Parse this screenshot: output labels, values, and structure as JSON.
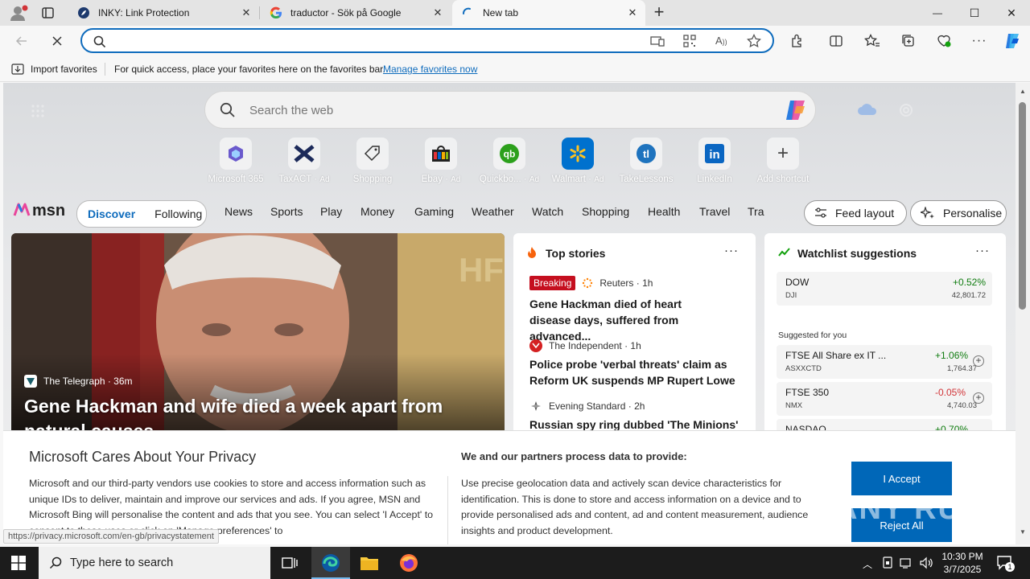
{
  "tabs": [
    {
      "title": "INKY: Link Protection",
      "active": false
    },
    {
      "title": "traductor - Sök på Google",
      "active": false
    },
    {
      "title": "New tab",
      "active": true
    }
  ],
  "window_controls": {
    "minimize": "—",
    "maximize": "☐",
    "close": "✕"
  },
  "address": {
    "value": "",
    "placeholder": ""
  },
  "favorites_bar": {
    "import_label": "Import favorites",
    "hint": "For quick access, place your favorites here on the favorites bar.",
    "manage_link": "Manage favorites now"
  },
  "newtab": {
    "search_placeholder": "Search the web",
    "shortcuts": [
      {
        "label": "Microsoft 365",
        "ad": ""
      },
      {
        "label": "TaxACT",
        "ad": "Ad"
      },
      {
        "label": "Shopping",
        "ad": ""
      },
      {
        "label": "Ebay",
        "ad": "Ad"
      },
      {
        "label": "Quickbo...",
        "ad": "Ad"
      },
      {
        "label": "Walmart",
        "ad": "Ad"
      },
      {
        "label": "TakeLessons",
        "ad": ""
      },
      {
        "label": "LinkedIn",
        "ad": ""
      },
      {
        "label": "Add shortcut",
        "ad": ""
      }
    ]
  },
  "msn": {
    "logo": "msn",
    "discover": "Discover",
    "following": "Following",
    "nav": [
      "News",
      "Sports",
      "Play",
      "Money",
      "Gaming",
      "Weather",
      "Watch",
      "Shopping",
      "Health",
      "Travel",
      "Tra"
    ],
    "feed_layout": "Feed layout",
    "personalise": "Personalise"
  },
  "hero": {
    "source": "The Telegraph",
    "age": "36m",
    "headline": "Gene Hackman and wife died a week apart from natural causes"
  },
  "top_stories": {
    "title": "Top stories",
    "items": [
      {
        "badge": "Breaking",
        "source": "Reuters",
        "age": "1h",
        "headline": "Gene Hackman died of heart disease days, suffered from advanced..."
      },
      {
        "badge": "",
        "source": "The Independent",
        "age": "1h",
        "headline": "Police probe 'verbal threats' claim as Reform UK suspends MP Rupert Lowe"
      },
      {
        "badge": "",
        "source": "Evening Standard",
        "age": "2h",
        "headline": "Russian spy ring dubbed 'The Minions'"
      }
    ]
  },
  "watchlist": {
    "title": "Watchlist suggestions",
    "suggested_label": "Suggested for you",
    "items": [
      {
        "name": "DOW",
        "ticker": "DJI",
        "change": "+0.52%",
        "price": "42,801.72"
      },
      {
        "name": "FTSE All Share ex IT ...",
        "ticker": "ASXXCTD",
        "change": "+1.06%",
        "price": "1,764.37"
      },
      {
        "name": "FTSE 350",
        "ticker": "NMX",
        "change": "-0.05%",
        "price": "4,740.03"
      },
      {
        "name": "NASDAQ",
        "ticker": "",
        "change": "+0.70%",
        "price": ""
      }
    ]
  },
  "privacy": {
    "title": "Microsoft Cares About Your Privacy",
    "body": "Microsoft and our third-party vendors use cookies to store and access information such as unique IDs to deliver, maintain and improve our services and ads. If you agree, MSN and Microsoft Bing will personalise the content and ads that you see. You can select 'I Accept' to consent to these uses or click on 'Manage preferences' to",
    "right_title": "We and our partners process data to provide:",
    "right_body": "Use precise geolocation data and actively scan device characteristics for identification. This is done to store and access information on a device and to provide personalised ads and content, ad and content measurement, audience insights and product development.",
    "accept": "I Accept",
    "reject": "Reject All"
  },
  "status_url": "https://privacy.microsoft.com/en-gb/privacystatement",
  "taskbar": {
    "search_placeholder": "Type here to search",
    "time": "10:30 PM",
    "date": "3/7/2025",
    "notif_count": "1"
  },
  "watermark": "ANY RUN",
  "colors": {
    "accent": "#0f6cbd",
    "breaking": "#c50f1f",
    "positive": "#107c10",
    "negative": "#d13438",
    "button": "#0067b8"
  }
}
